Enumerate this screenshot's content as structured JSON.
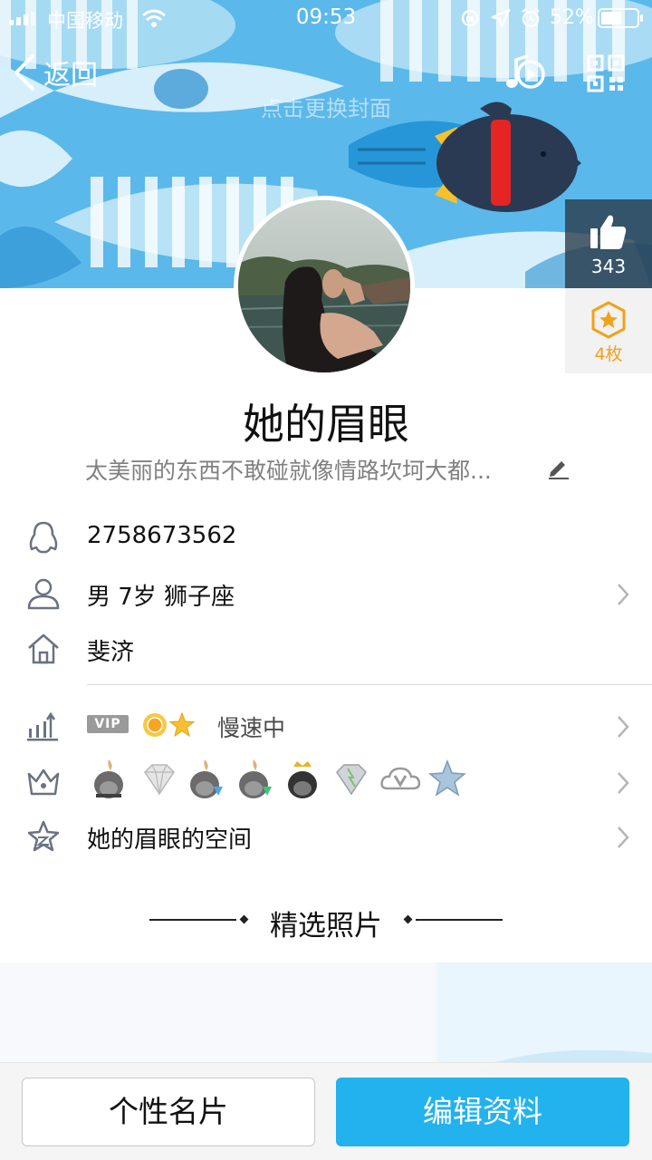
{
  "status_bar": {
    "carrier": "中国移动",
    "time": "09:53",
    "battery": "52%"
  },
  "header": {
    "back_label": "返回",
    "cover_hint": "点击更换封面",
    "music_icon": "music-play-icon",
    "qr_icon": "qr-code-icon"
  },
  "likes": {
    "count": "343",
    "icon": "thumbs-up-icon"
  },
  "medals": {
    "count": "4枚",
    "icon": "star-hexagon-icon"
  },
  "profile": {
    "nickname": "她的眉眼",
    "signature": "太美丽的东西不敢碰就像情路坎坷大都..."
  },
  "info": {
    "qq_number": "2758673562",
    "basic": "男 7岁 狮子座",
    "hometown": "斐济"
  },
  "level": {
    "vip_tag": "VIP",
    "status": "慢速中"
  },
  "services": {
    "badges": [
      "qq-penguin-flame-icon",
      "diamond-icon",
      "penguin-blue-diamond-icon",
      "penguin-green-diamond-icon",
      "penguin-crown-icon",
      "silver-diamond-icon",
      "vip-cloud-icon",
      "blue-star-icon"
    ]
  },
  "space": {
    "label": "她的眉眼的空间"
  },
  "featured": {
    "title": "精选照片"
  },
  "actions": {
    "card_label": "个性名片",
    "edit_label": "编辑资料"
  },
  "colors": {
    "cover_blue": "#5bb8ea",
    "primary_button": "#22b2ee",
    "medal_orange": "#f2a11b"
  }
}
